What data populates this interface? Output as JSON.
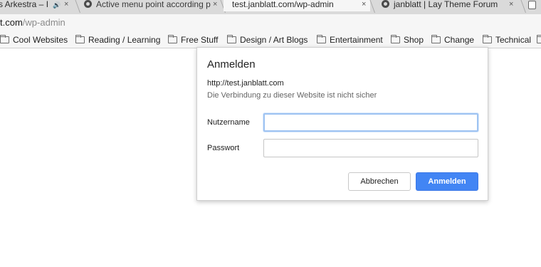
{
  "tabs": [
    {
      "title": "s Arkestra – I",
      "audio_icon": "speaker-icon",
      "close": "×",
      "active": false
    },
    {
      "title": "Active menu point according p",
      "favicon": "github-icon",
      "close": "×",
      "active": false
    },
    {
      "title": "test.janblatt.com/wp-admin",
      "close": "×",
      "active": true
    },
    {
      "title": "janblatt | Lay Theme Forum",
      "favicon": "github-icon",
      "close": "×",
      "active": false
    }
  ],
  "speaker_glyph": "🔊",
  "address": {
    "host": "t.com",
    "path": "/wp-admin"
  },
  "bookmarks": [
    {
      "label": "Cool Websites"
    },
    {
      "label": "Reading / Learning"
    },
    {
      "label": "Free Stuff"
    },
    {
      "label": "Design / Art Blogs"
    },
    {
      "label": "Entertainment"
    },
    {
      "label": "Shop"
    },
    {
      "label": "Change"
    },
    {
      "label": "Technical"
    }
  ],
  "dialog": {
    "title": "Anmelden",
    "origin": "http://test.janblatt.com",
    "warning": "Die Verbindung zu dieser Website ist nicht sicher",
    "username_label": "Nutzername",
    "username_value": "",
    "password_label": "Passwort",
    "password_value": "",
    "cancel_label": "Abbrechen",
    "submit_label": "Anmelden"
  },
  "colors": {
    "primary_button": "#4285f4",
    "focus_ring": "#9ec3f2"
  }
}
